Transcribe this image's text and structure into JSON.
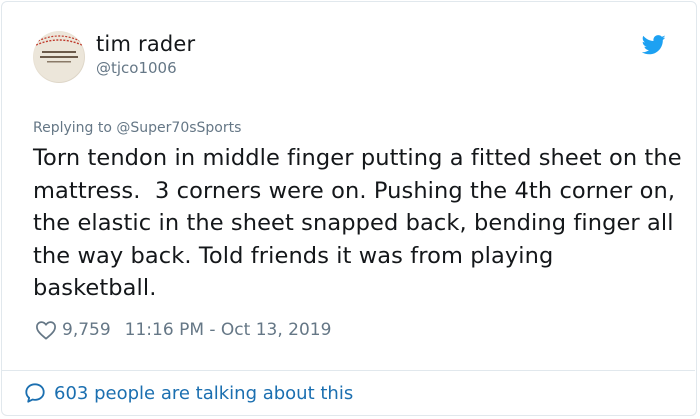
{
  "user": {
    "display_name": "tim rader",
    "handle": "@tjco1006",
    "avatar_icon": "baseball-avatar"
  },
  "reply": {
    "prefix": "Replying to ",
    "mention": "@Super70sSports"
  },
  "tweet": {
    "text": "Torn tendon in middle finger putting a fitted sheet on the mattress.  3 corners were on. Pushing the 4th corner on, the elastic in the sheet snapped back, bending finger all the way back. Told friends it was from playing basketball."
  },
  "meta": {
    "likes": "9,759",
    "timestamp": "11:16 PM - Oct 13, 2019",
    "like_icon": "heart-icon"
  },
  "footer": {
    "talking": "603 people are talking about this",
    "icon": "speech-bubble-icon"
  },
  "colors": {
    "twitter_blue": "#1da1f2",
    "link_blue": "#1b6fb0",
    "secondary_text": "#657786",
    "primary_text": "#14171a",
    "border": "#e1e8ed"
  }
}
